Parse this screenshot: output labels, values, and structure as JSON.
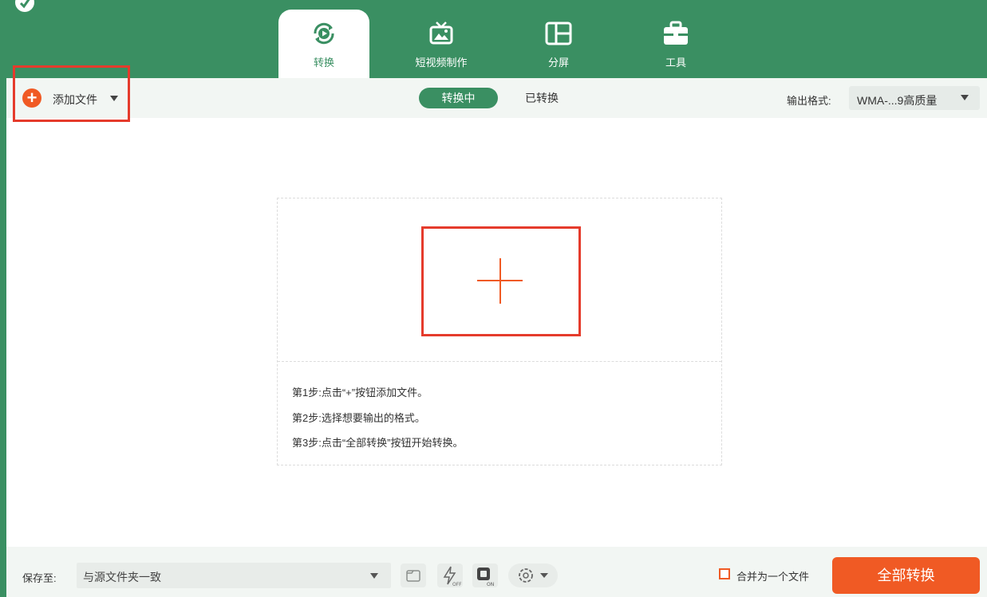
{
  "nav": {
    "tabs": [
      {
        "label": "转换",
        "icon": "convert-icon",
        "active": true
      },
      {
        "label": "短视频制作",
        "icon": "tv-icon",
        "active": false
      },
      {
        "label": "分屏",
        "icon": "split-screen-icon",
        "active": false
      },
      {
        "label": "工具",
        "icon": "toolbox-icon",
        "active": false
      }
    ]
  },
  "toolbar": {
    "add_file_label": "添加文件",
    "segments": [
      "转换中",
      "已转换"
    ],
    "output_format_label": "输出格式:",
    "output_format_value": "WMA-...9高质量"
  },
  "dropzone": {
    "steps": [
      "第1步:点击“+”按钮添加文件。",
      "第2步:选择想要输出的格式。",
      "第3步:点击“全部转换”按钮开始转换。"
    ]
  },
  "footer": {
    "save_to_label": "保存至:",
    "save_path_value": "与源文件夹一致",
    "merge_label": "合并为一个文件",
    "merge_checked": false,
    "convert_all_label": "全部转换"
  },
  "colors": {
    "brand_green": "#3a8f62",
    "accent_orange": "#f05a24",
    "highlight_red": "#e53b2c"
  }
}
